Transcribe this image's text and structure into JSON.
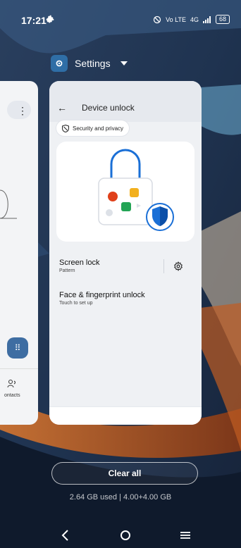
{
  "status_bar": {
    "time": "17:21",
    "network": "Vo LTE",
    "network_gen": "4G",
    "battery": "68"
  },
  "app_switcher": {
    "app_label": "Settings",
    "left_card": {
      "contacts_label": "ontacts"
    },
    "card": {
      "title": "Device unlock",
      "chip_label": "Security and privacy",
      "rows": [
        {
          "title": "Screen lock",
          "subtitle": "Pattern"
        },
        {
          "title": "Face & fingerprint unlock",
          "subtitle": "Touch to set up"
        }
      ]
    },
    "clear_all_label": "Clear all",
    "memory": {
      "used": "2.64 GB used",
      "separator": "|",
      "total": "4.00+4.00 GB"
    }
  },
  "colors": {
    "accent_blue": "#1a6fd6",
    "fab_blue": "#3e6da2"
  }
}
